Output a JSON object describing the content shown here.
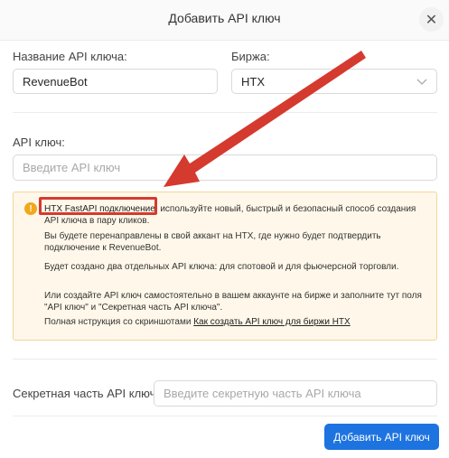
{
  "dialog": {
    "title": "Добавить API ключ",
    "close_glyph": "✕"
  },
  "fields": {
    "key_name": {
      "label": "Название API ключа:",
      "value": "RevenueBot"
    },
    "exchange": {
      "label": "Биржа:",
      "value": "HTX"
    },
    "api_key": {
      "label": "API ключ:",
      "placeholder": "Введите API ключ"
    },
    "secret": {
      "label": "Секретная часть API ключа:",
      "placeholder": "Введите секретную часть API ключа"
    }
  },
  "notice": {
    "icon": "!",
    "link_text": "HTX FastAPI подключение",
    "line1_rest": ", используйте новый, быстрый и безопасный способ создания",
    "line2": "API ключа в пару кликов.",
    "redirect_line1": "Вы будете перенаправлены в свой аккант на HTX, где нужно будет подтвердить",
    "redirect_line2": "подключение к RevenueBot.",
    "two_keys": "Будет создано два отдельных API ключа: для спотовой и для фьючерсной торговли.",
    "manual_line1": "Или создайте API ключ самостоятельно в вашем аккаунте на бирже и заполните тут поля",
    "manual_line2": "\"API ключ\" и \"Секретная часть API ключа\".",
    "guide_prefix": "Полная нструкция со скриншотами ",
    "guide_link": "Как создать API ключ для биржи HTX"
  },
  "submit_label": "Добавить API ключ",
  "colors": {
    "primary": "#1d73e0",
    "annotation_red": "#d53a2f",
    "warning": "#f0a81c"
  }
}
